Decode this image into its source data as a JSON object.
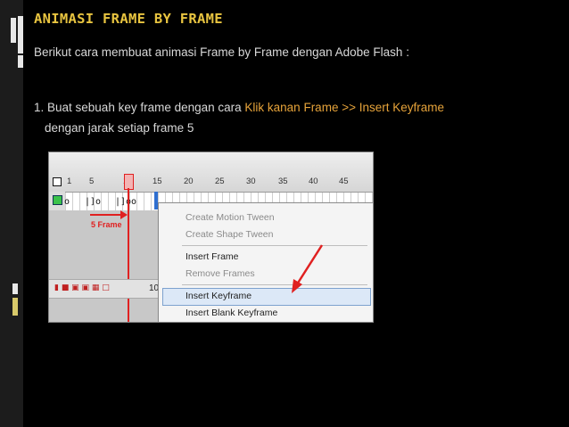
{
  "slide": {
    "title": "ANIMASI FRAME BY FRAME",
    "intro": "Berikut cara membuat animasi Frame by Frame dengan Adobe Flash :",
    "step1_prefix": "1. Buat sebuah key frame dengan cara ",
    "step1_highlight": "Klik kanan Frame >> Insert Keyframe",
    "step1_cont": "dengan jarak setiap frame 5"
  },
  "timeline": {
    "ticks": [
      "1",
      "5",
      "10",
      "15",
      "20",
      "25",
      "30",
      "35",
      "40",
      "45"
    ],
    "annotation": "5 Frame",
    "fps_value": "10"
  },
  "context_menu": {
    "items": [
      {
        "label": "Create Motion Tween",
        "enabled": false
      },
      {
        "label": "Create Shape Tween",
        "enabled": false
      },
      {
        "label": "Insert Frame",
        "enabled": true
      },
      {
        "label": "Remove Frames",
        "enabled": false
      },
      {
        "label": "Insert Keyframe",
        "enabled": true,
        "selected": true
      },
      {
        "label": "Insert Blank Keyframe",
        "enabled": true
      }
    ]
  },
  "colors": {
    "title": "#e8c440",
    "highlight": "#e6a33a",
    "annotation_red": "#e02020"
  }
}
